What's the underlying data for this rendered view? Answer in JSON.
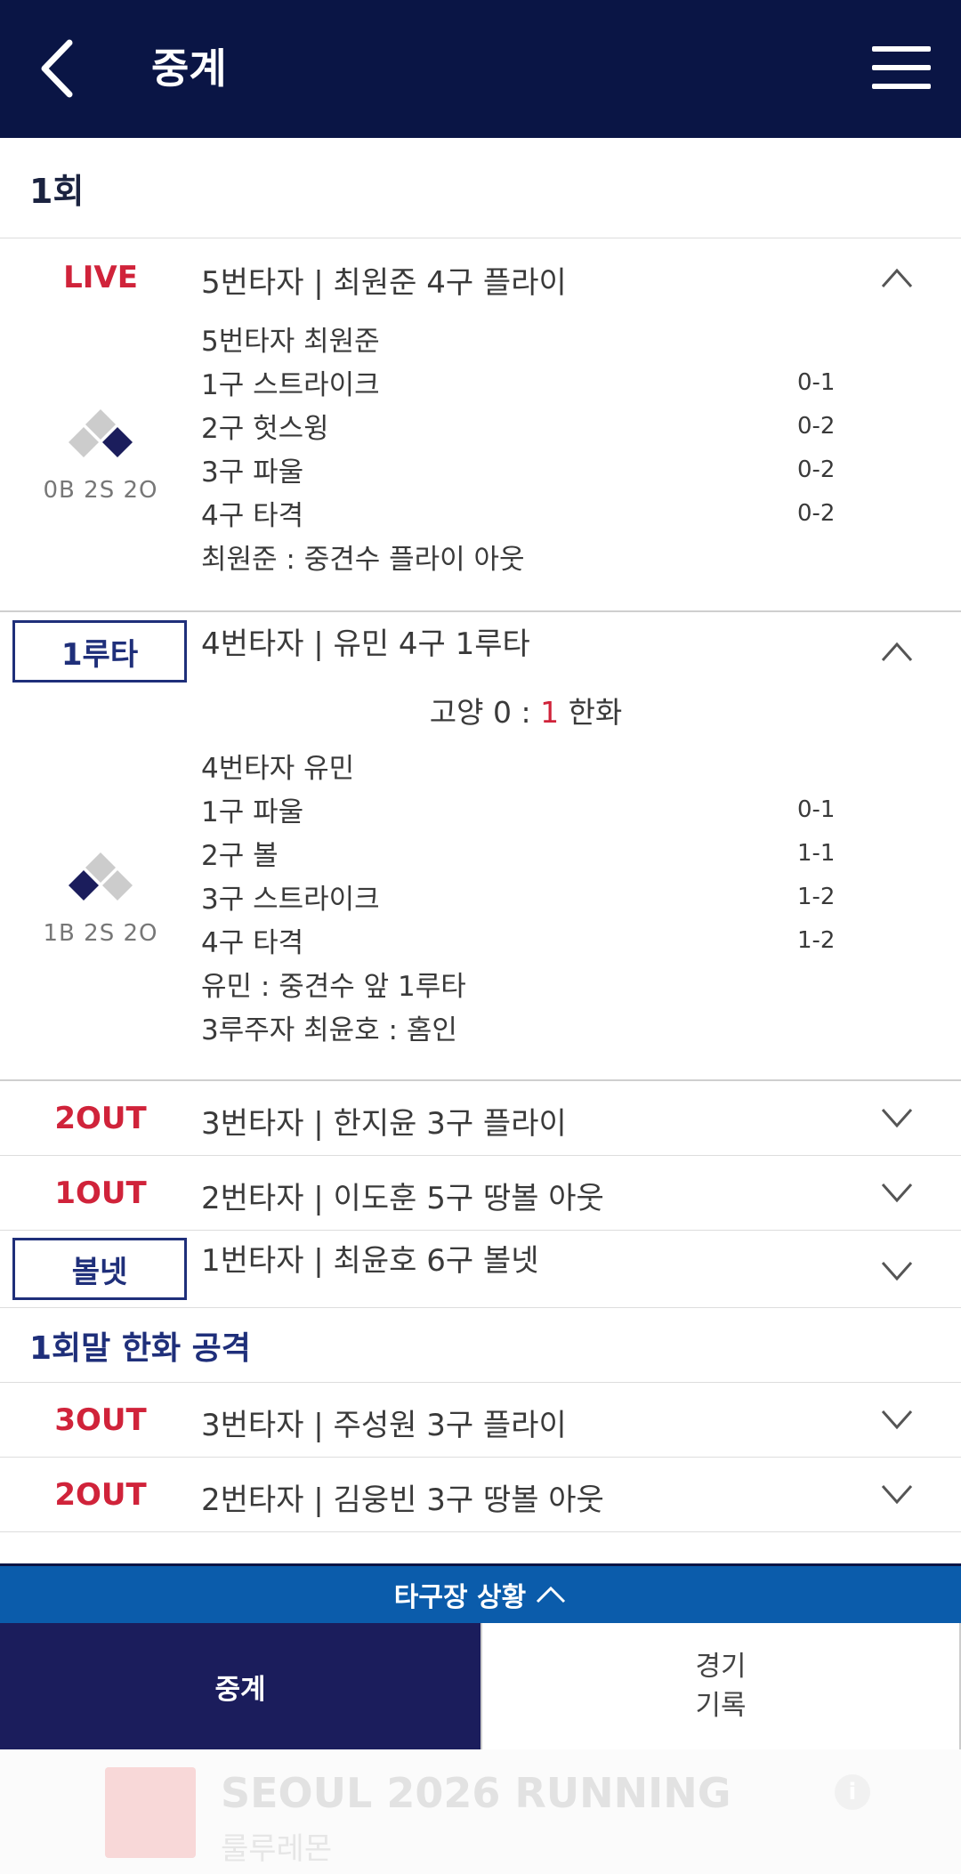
{
  "header": {
    "title": "중계"
  },
  "inning_title": "1회",
  "plays": [
    {
      "status": "LIVE",
      "summary": "5번타자 | 최원준 4구 플라이",
      "batter_line": "5번타자 최원준",
      "pitches": [
        {
          "label": "1구 스트라이크",
          "count": "0-1"
        },
        {
          "label": "2구 헛스윙",
          "count": "0-2"
        },
        {
          "label": "3구 파울",
          "count": "0-2"
        },
        {
          "label": "4구 타격",
          "count": "0-2"
        }
      ],
      "result": "최원준 : 중견수 플라이 아웃",
      "count_display": "0B 2S 2O"
    },
    {
      "status": "1루타",
      "summary": "4번타자 | 유민 4구 1루타",
      "score": {
        "away": "고양",
        "away_score": "0",
        "sep": ":",
        "home_score": "1",
        "home": "한화"
      },
      "batter_line": "4번타자 유민",
      "pitches": [
        {
          "label": "1구 파울",
          "count": "0-1"
        },
        {
          "label": "2구 볼",
          "count": "1-1"
        },
        {
          "label": "3구 스트라이크",
          "count": "1-2"
        },
        {
          "label": "4구 타격",
          "count": "1-2"
        }
      ],
      "result": "유민 : 중견수 앞 1루타",
      "runner_result": "3루주자 최윤호 : 홈인",
      "count_display": "1B 2S 2O"
    },
    {
      "status": "2OUT",
      "summary": "3번타자 | 한지윤 3구 플라이"
    },
    {
      "status": "1OUT",
      "summary": "2번타자 | 이도훈 5구 땅볼 아웃"
    },
    {
      "status": "볼넷",
      "summary": "1번타자 | 최윤호 6구 볼넷"
    }
  ],
  "half_title": "1회말 한화 공격",
  "plays_bottom": [
    {
      "status": "3OUT",
      "summary": "3번타자 | 주성원 3구 플라이"
    },
    {
      "status": "2OUT",
      "summary": "2번타자 | 김웅빈 3구 땅볼 아웃"
    }
  ],
  "field_bar": {
    "label": "타구장 상황"
  },
  "tabs": {
    "broadcast": "중계",
    "records": "경기\n기록"
  },
  "ad": {
    "title": "SEOUL 2026 RUNNING",
    "subtitle": "룰루레몬"
  },
  "colors": {
    "header_bg": "#0a1545",
    "accent_red": "#d0233a",
    "navy": "#1f2f7a",
    "field_bar": "#0b5cab",
    "active_tab": "#1b1d5c"
  }
}
